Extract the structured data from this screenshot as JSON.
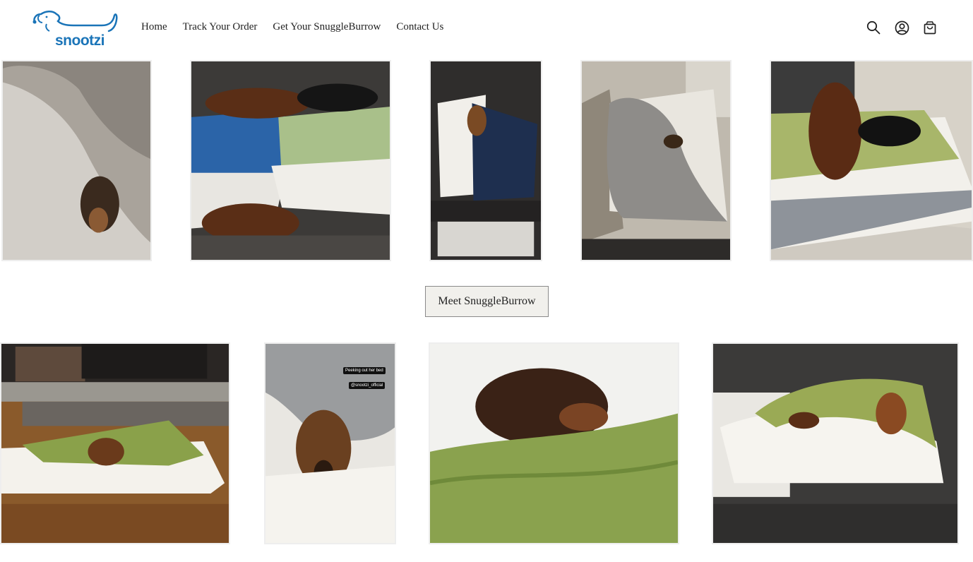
{
  "brand": {
    "name": "snootzi",
    "color": "#1a74b8"
  },
  "nav": {
    "items": [
      {
        "label": "Home"
      },
      {
        "label": "Track Your Order"
      },
      {
        "label": "Get Your SnuggleBurrow"
      },
      {
        "label": "Contact Us"
      }
    ]
  },
  "header_icons": [
    "search-icon",
    "account-icon",
    "cart-icon"
  ],
  "gallery": {
    "button_label": "Meet SnuggleBurrow",
    "caption_tags": [
      "Peeking out her bed",
      "@snootzi_official"
    ]
  }
}
